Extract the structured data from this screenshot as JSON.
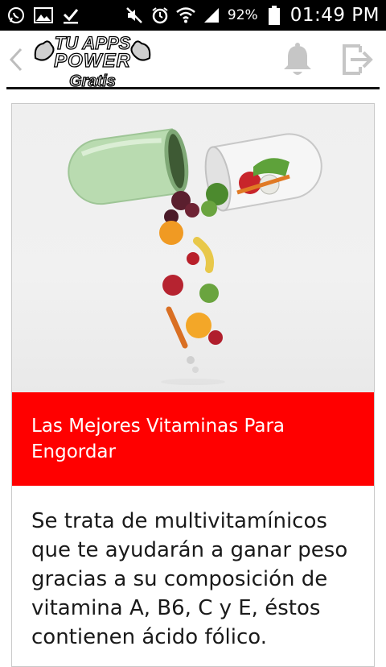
{
  "status_bar": {
    "battery_percent": "92%",
    "time": "01:49 PM",
    "icons": [
      "whatsapp-icon",
      "gallery-icon",
      "download-done-icon",
      "mute-icon",
      "alarm-icon",
      "wifi-icon",
      "signal-icon",
      "battery-icon"
    ]
  },
  "app_bar": {
    "logo": {
      "line1": "TU APPS",
      "line2": "POWER",
      "line3": "Gratis"
    },
    "icons": [
      "back-icon",
      "bell-icon",
      "exit-icon"
    ]
  },
  "card": {
    "title": "Las Mejores Vitaminas Para Engordar",
    "description": "Se trata de multivitamínicos que te ayudarán a ganar peso gracias a su composición de vitamina A, B6, C y E, éstos contienen ácido fólico.",
    "banner_color": "#ff0000"
  }
}
